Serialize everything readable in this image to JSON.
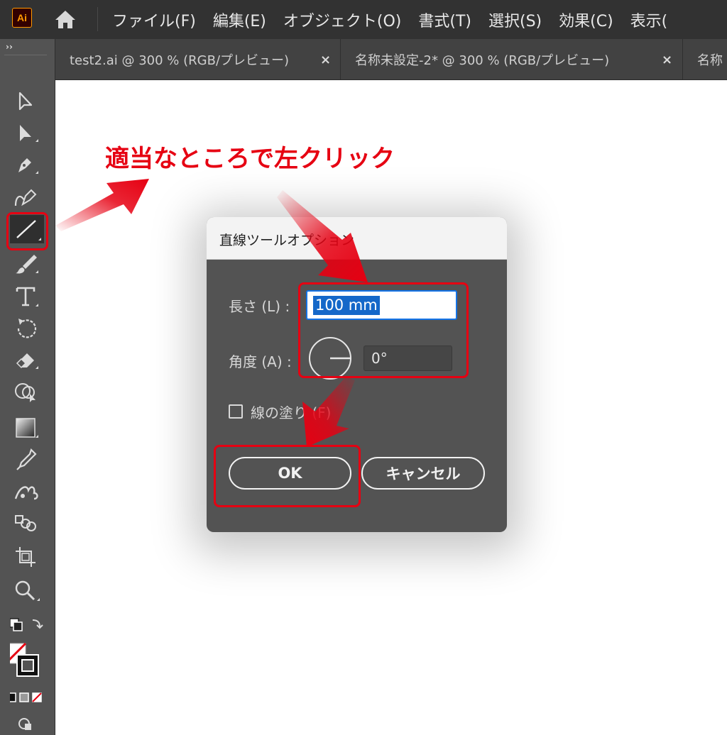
{
  "app": {
    "logo_text": "Ai",
    "accent_color": "#ff9a00"
  },
  "menu": {
    "items": [
      "ファイル(F)",
      "編集(E)",
      "オブジェクト(O)",
      "書式(T)",
      "選択(S)",
      "効果(C)",
      "表示("
    ]
  },
  "tabs": [
    {
      "label": "test2.ai @ 300 % (RGB/プレビュー)",
      "close": "×"
    },
    {
      "label": "名称未設定-2* @ 300 % (RGB/プレビュー)",
      "close": "×"
    },
    {
      "label": "名称"
    }
  ],
  "toolbar": {
    "collapse_label": "››",
    "tools": [
      "selection",
      "direct-selection",
      "pen",
      "curvature",
      "line-segment",
      "paintbrush",
      "type",
      "rotate",
      "eraser",
      "shape-builder",
      "gradient",
      "eyedropper",
      "symbol-sprayer",
      "blend",
      "artboard",
      "zoom"
    ]
  },
  "annotation": {
    "instruction": "適当なところで左クリック",
    "highlight_color": "#e60012"
  },
  "dialog": {
    "title": "直線ツールオプション",
    "length_label": "長さ (L) :",
    "length_value": "100 mm",
    "angle_label": "角度 (A) :",
    "angle_value": "0°",
    "fill_label": "線の塗り (F)",
    "fill_checked": false,
    "ok_label": "OK",
    "cancel_label": "キャンセル"
  }
}
